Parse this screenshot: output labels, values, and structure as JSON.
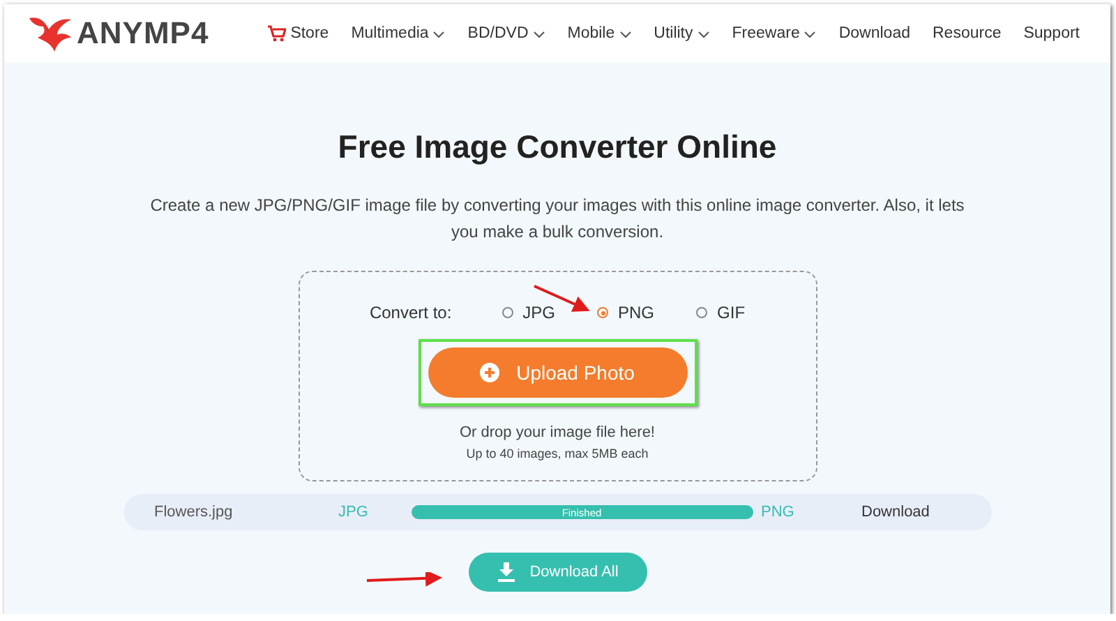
{
  "logo": {
    "name": "ANYMP4"
  },
  "nav": [
    {
      "label": "Store",
      "kind": "cart"
    },
    {
      "label": "Multimedia",
      "kind": "dropdown"
    },
    {
      "label": "BD/DVD",
      "kind": "dropdown"
    },
    {
      "label": "Mobile",
      "kind": "dropdown"
    },
    {
      "label": "Utility",
      "kind": "dropdown"
    },
    {
      "label": "Freeware",
      "kind": "dropdown"
    },
    {
      "label": "Download",
      "kind": "link"
    },
    {
      "label": "Resource",
      "kind": "link"
    },
    {
      "label": "Support",
      "kind": "link"
    }
  ],
  "title": "Free Image Converter Online",
  "description": "Create a new JPG/PNG/GIF image file by converting your images with this online image converter. Also, it lets you make a bulk conversion.",
  "converter": {
    "convert_label": "Convert to:",
    "formats": [
      {
        "label": "JPG",
        "selected": false
      },
      {
        "label": "PNG",
        "selected": true
      },
      {
        "label": "GIF",
        "selected": false
      }
    ],
    "upload_button": "Upload Photo",
    "drop_hint": "Or drop your image file here!",
    "limit_note": "Up to 40 images, max 5MB each"
  },
  "files": [
    {
      "name": "Flowers.jpg",
      "from": "JPG",
      "status": "Finished",
      "level": 1,
      "to": "PNG",
      "action": "Download"
    }
  ],
  "download_all": "Download All"
}
